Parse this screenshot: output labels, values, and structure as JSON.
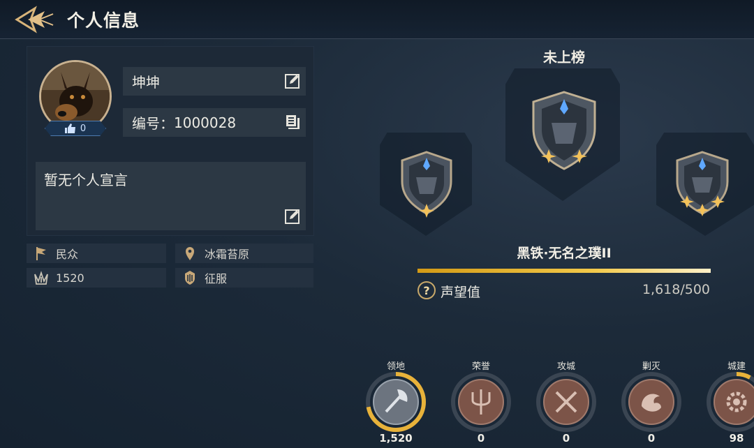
{
  "header": {
    "title": "个人信息"
  },
  "profile": {
    "name": "坤坤",
    "id_label": "编号：",
    "id_value": "1000028",
    "likes": "0",
    "manifesto": "暂无个人宣言"
  },
  "info": {
    "identity": "民众",
    "location": "冰霜苔原",
    "power": "1520",
    "status": "征服"
  },
  "rank": {
    "leaderboard_status": "未上榜",
    "tier_name": "黑铁·无名之璞II",
    "prestige_label": "声望值",
    "prestige_value": "1,618/500",
    "prestige_progress": 1.0
  },
  "achievements": [
    {
      "label": "领地",
      "value": "1,520",
      "icon": "axe-icon",
      "progress": 0.72
    },
    {
      "label": "荣誉",
      "value": "0",
      "icon": "trident-icon",
      "progress": 0
    },
    {
      "label": "攻城",
      "value": "0",
      "icon": "crossed-swords-icon",
      "progress": 0
    },
    {
      "label": "剿灭",
      "value": "0",
      "icon": "dragon-icon",
      "progress": 0
    },
    {
      "label": "城建",
      "value": "98",
      "icon": "gear-icon",
      "progress": 0.08
    }
  ],
  "colors": {
    "accent_gold": "#f2c94a",
    "panel": "#1d2937",
    "field": "#2c3844"
  }
}
